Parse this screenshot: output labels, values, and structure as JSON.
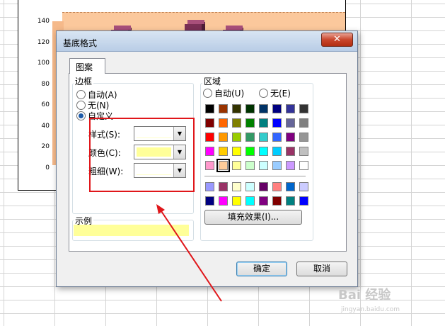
{
  "chart": {
    "y_ticks": [
      "140",
      "120",
      "100",
      "80",
      "60",
      "40",
      "20",
      "0"
    ],
    "bar_values": [
      140,
      140
    ]
  },
  "dialog": {
    "title": "基底格式",
    "close_label": "✕",
    "tab_label": "图案",
    "border": {
      "group_label": "边框",
      "options": [
        "自动(A)",
        "无(N)",
        "自定义"
      ],
      "selected": "自定义",
      "style_label": "样式(S):",
      "color_label": "颜色(C):",
      "weight_label": "粗细(W):",
      "color_value": "#ffff99"
    },
    "area": {
      "group_label": "区域",
      "options": [
        "自动(U)",
        "无(E)"
      ],
      "fill_effect_label": "填充效果(I)...",
      "selected_color": "#ffcc99"
    },
    "sample": {
      "label": "示例",
      "color": "#ffff99"
    },
    "ok_label": "确定",
    "cancel_label": "取消"
  },
  "palette": {
    "rows": [
      [
        "#000000",
        "#993300",
        "#333300",
        "#003300",
        "#003366",
        "#000080",
        "#333399",
        "#333333"
      ],
      [
        "#800000",
        "#ff6600",
        "#808000",
        "#008000",
        "#008080",
        "#0000ff",
        "#666699",
        "#808080"
      ],
      [
        "#ff0000",
        "#ff9900",
        "#99cc00",
        "#339966",
        "#33cccc",
        "#3366ff",
        "#800080",
        "#969696"
      ],
      [
        "#ff00ff",
        "#ffcc00",
        "#ffff00",
        "#00ff00",
        "#00ffff",
        "#00ccff",
        "#993366",
        "#c0c0c0"
      ],
      [
        "#ff99cc",
        "#ffcc99",
        "#ffff99",
        "#ccffcc",
        "#ccffff",
        "#99ccff",
        "#cc99ff",
        "#ffffff"
      ]
    ],
    "extra_rows": [
      [
        "#9999ff",
        "#993366",
        "#ffffcc",
        "#ccffff",
        "#660066",
        "#ff8080",
        "#0066cc",
        "#ccccff"
      ],
      [
        "#000080",
        "#ff00ff",
        "#ffff00",
        "#00ffff",
        "#800080",
        "#800000",
        "#008080",
        "#0000ff"
      ]
    ]
  },
  "watermark": {
    "text": "Bai 经验",
    "sub": "jingyan.baidu.com"
  },
  "colors": {
    "annotation_red": "#e0161a",
    "titlebar": "#c6d7ec"
  }
}
